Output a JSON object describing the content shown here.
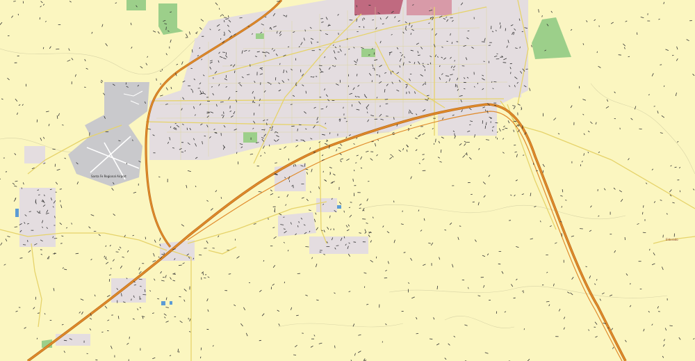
{
  "map": {
    "colors": {
      "land": "#fbf6c0",
      "urban": "#e4dde0",
      "airport": "#c9c9cc",
      "park": "#9ccf8a",
      "freeway": "#e08a2a",
      "freeway_casing": "#b86a1a",
      "arterial": "#e6d36a",
      "minor_road": "#ded29a",
      "downtown": "#c06a80",
      "water": "#5b9bd5",
      "contour": "#c9c6a0"
    },
    "labels": {
      "airport": "Santa Fe Regional Airport",
      "east_poi": "Eldorado"
    }
  }
}
